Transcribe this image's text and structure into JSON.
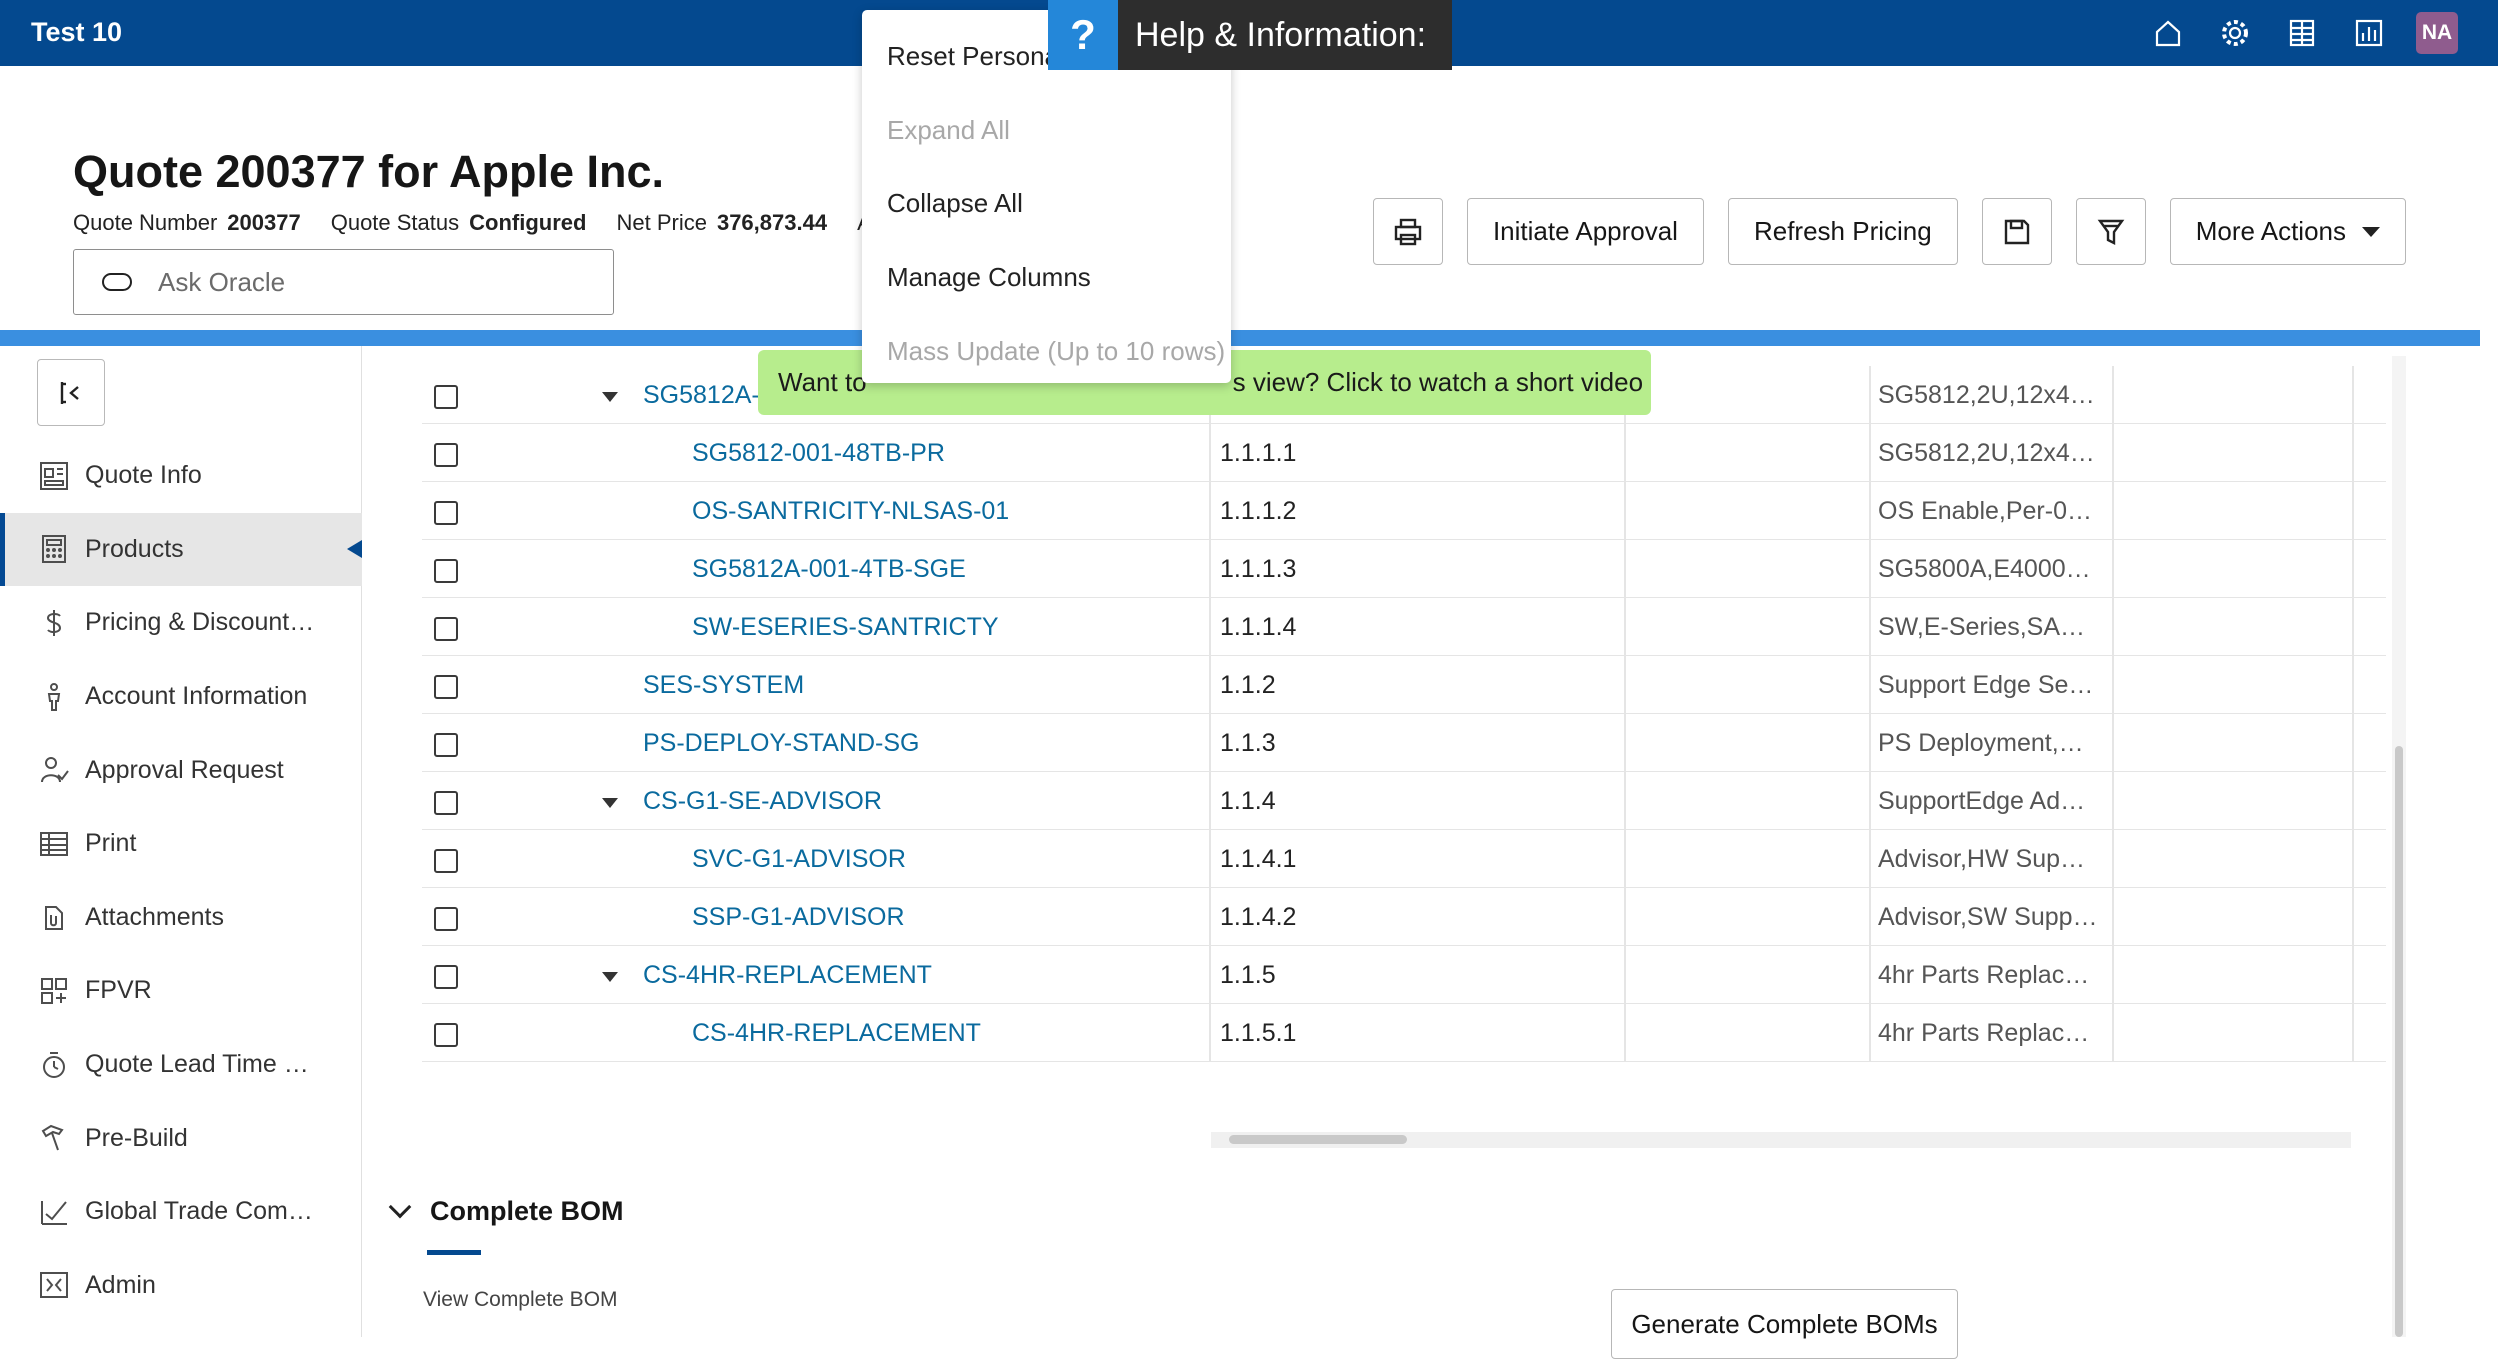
{
  "app": {
    "title": "Test 10",
    "avatar_initials": "NA",
    "top_icons": [
      "home-icon",
      "gear-icon",
      "reports-icon",
      "analytics-icon"
    ]
  },
  "help": {
    "icon": "?",
    "label": "Help & Information:"
  },
  "quote": {
    "title": "Quote 200377 for Apple Inc.",
    "number_label": "Quote Number",
    "number": "200377",
    "status_label": "Quote Status",
    "status": "Configured",
    "net_price_label": "Net Price",
    "net_price": "376,873.44",
    "truncated_field": "A"
  },
  "ask": {
    "placeholder": "Ask Oracle"
  },
  "toolbar": {
    "initiate_approval": "Initiate Approval",
    "refresh_pricing": "Refresh Pricing",
    "more_actions": "More Actions"
  },
  "sidebar": {
    "items": [
      {
        "label": "Quote Info",
        "icon": "dashboard-icon"
      },
      {
        "label": "Products",
        "icon": "calculator-icon",
        "active": true
      },
      {
        "label": "Pricing & Discount…",
        "icon": "dollar-icon"
      },
      {
        "label": "Account Information",
        "icon": "person-icon"
      },
      {
        "label": "Approval Request",
        "icon": "user-check-icon"
      },
      {
        "label": "Print",
        "icon": "table-icon"
      },
      {
        "label": "Attachments",
        "icon": "attachment-icon"
      },
      {
        "label": "FPVR",
        "icon": "grid-plus-icon"
      },
      {
        "label": "Quote Lead Time …",
        "icon": "stopwatch-icon"
      },
      {
        "label": "Pre-Build",
        "icon": "hammer-icon"
      },
      {
        "label": "Global Trade Com…",
        "icon": "checkmark-icon"
      },
      {
        "label": "Admin",
        "icon": "admin-icon"
      }
    ]
  },
  "menu": {
    "items": [
      {
        "label": "Reset Personal",
        "disabled": false
      },
      {
        "label": "Expand All",
        "disabled": true
      },
      {
        "label": "Collapse All",
        "disabled": false
      },
      {
        "label": "Manage Columns",
        "disabled": false
      },
      {
        "label": "Mass Update (Up to 10 rows)",
        "disabled": true
      }
    ]
  },
  "banner": {
    "text": "Want to s view? Click to watch a short video",
    "visible_left": "Want to",
    "visible_right": "s view? Click to watch a short video"
  },
  "rows": [
    {
      "part": "SG5812A-",
      "line": "",
      "desc": "SG5812,2U,12x4…",
      "level": 2,
      "expand": true
    },
    {
      "part": "SG5812-001-48TB-PR",
      "line": "1.1.1.1",
      "desc": "SG5812,2U,12x4…",
      "level": 3
    },
    {
      "part": "OS-SANTRICITY-NLSAS-01",
      "line": "1.1.1.2",
      "desc": "OS Enable,Per-0.…",
      "level": 3
    },
    {
      "part": "SG5812A-001-4TB-SGE",
      "line": "1.1.1.3",
      "desc": "SG5800A,E4000…",
      "level": 3
    },
    {
      "part": "SW-ESERIES-SANTRICTY",
      "line": "1.1.1.4",
      "desc": "SW,E-Series,SAN…",
      "level": 3
    },
    {
      "part": "SES-SYSTEM",
      "line": "1.1.2",
      "desc": "Support Edge Ser…",
      "level": 2
    },
    {
      "part": "PS-DEPLOY-STAND-SG",
      "line": "1.1.3",
      "desc": "PS Deployment,S…",
      "level": 2
    },
    {
      "part": "CS-G1-SE-ADVISOR",
      "line": "1.1.4",
      "desc": "SupportEdge Ad…",
      "level": 2,
      "expand": true
    },
    {
      "part": "SVC-G1-ADVISOR",
      "line": "1.1.4.1",
      "desc": "Advisor,HW Supp…",
      "level": 3
    },
    {
      "part": "SSP-G1-ADVISOR",
      "line": "1.1.4.2",
      "desc": "Advisor,SW Supp…",
      "level": 3
    },
    {
      "part": "CS-4HR-REPLACEMENT",
      "line": "1.1.5",
      "desc": "4hr Parts Replace…",
      "level": 2,
      "expand": true
    },
    {
      "part": "CS-4HR-REPLACEMENT",
      "line": "1.1.5.1",
      "desc": "4hr Parts Replace…",
      "level": 3
    }
  ],
  "bom": {
    "title": "Complete BOM",
    "subtitle": "View Complete BOM",
    "generate_label": "Generate Complete BOMs"
  }
}
